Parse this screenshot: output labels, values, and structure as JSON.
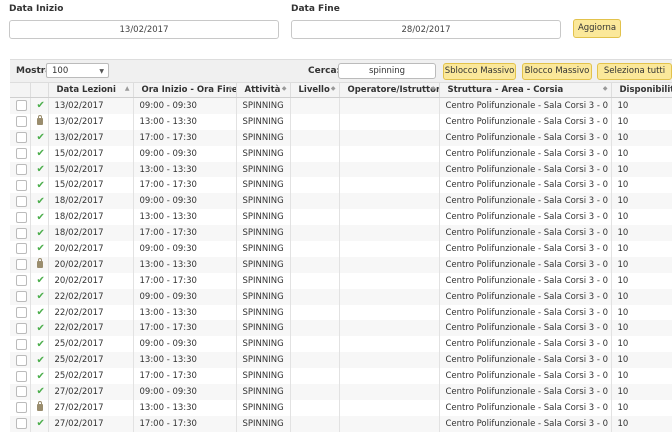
{
  "filters": {
    "start_label": "Data Inizio",
    "start_value": "13/02/2017",
    "end_label": "Data Fine",
    "end_value": "28/02/2017",
    "update_label": "Aggiorna"
  },
  "toolbar": {
    "show_label": "Mostra",
    "show_value": "100",
    "search_label": "Cerca:",
    "search_value": "spinning",
    "unlock_all": "Sblocco Massivo",
    "lock_all": "Blocco Massivo",
    "select_all": "Seleziona tutti"
  },
  "table": {
    "columns": [
      "Data Lezioni",
      "Ora Inizio - Ora Fine",
      "Attività",
      "Livello",
      "Operatore/Istruttore",
      "Struttura - Area - Corsia",
      "Disponibilità"
    ],
    "rows": [
      {
        "status": "check",
        "date": "13/02/2017",
        "time": "09:00 - 09:30",
        "activity": "SPINNING",
        "level": "",
        "operator": "",
        "structure": "Centro Polifunzionale - Sala Corsi 3 - 0",
        "avail": "10"
      },
      {
        "status": "lock",
        "date": "13/02/2017",
        "time": "13:00 - 13:30",
        "activity": "SPINNING",
        "level": "",
        "operator": "",
        "structure": "Centro Polifunzionale - Sala Corsi 3 - 0",
        "avail": "10"
      },
      {
        "status": "check",
        "date": "13/02/2017",
        "time": "17:00 - 17:30",
        "activity": "SPINNING",
        "level": "",
        "operator": "",
        "structure": "Centro Polifunzionale - Sala Corsi 3 - 0",
        "avail": "10"
      },
      {
        "status": "check",
        "date": "15/02/2017",
        "time": "09:00 - 09:30",
        "activity": "SPINNING",
        "level": "",
        "operator": "",
        "structure": "Centro Polifunzionale - Sala Corsi 3 - 0",
        "avail": "10"
      },
      {
        "status": "check",
        "date": "15/02/2017",
        "time": "13:00 - 13:30",
        "activity": "SPINNING",
        "level": "",
        "operator": "",
        "structure": "Centro Polifunzionale - Sala Corsi 3 - 0",
        "avail": "10"
      },
      {
        "status": "check",
        "date": "15/02/2017",
        "time": "17:00 - 17:30",
        "activity": "SPINNING",
        "level": "",
        "operator": "",
        "structure": "Centro Polifunzionale - Sala Corsi 3 - 0",
        "avail": "10"
      },
      {
        "status": "check",
        "date": "18/02/2017",
        "time": "09:00 - 09:30",
        "activity": "SPINNING",
        "level": "",
        "operator": "",
        "structure": "Centro Polifunzionale - Sala Corsi 3 - 0",
        "avail": "10"
      },
      {
        "status": "check",
        "date": "18/02/2017",
        "time": "13:00 - 13:30",
        "activity": "SPINNING",
        "level": "",
        "operator": "",
        "structure": "Centro Polifunzionale - Sala Corsi 3 - 0",
        "avail": "10"
      },
      {
        "status": "check",
        "date": "18/02/2017",
        "time": "17:00 - 17:30",
        "activity": "SPINNING",
        "level": "",
        "operator": "",
        "structure": "Centro Polifunzionale - Sala Corsi 3 - 0",
        "avail": "10"
      },
      {
        "status": "check",
        "date": "20/02/2017",
        "time": "09:00 - 09:30",
        "activity": "SPINNING",
        "level": "",
        "operator": "",
        "structure": "Centro Polifunzionale - Sala Corsi 3 - 0",
        "avail": "10"
      },
      {
        "status": "lock",
        "date": "20/02/2017",
        "time": "13:00 - 13:30",
        "activity": "SPINNING",
        "level": "",
        "operator": "",
        "structure": "Centro Polifunzionale - Sala Corsi 3 - 0",
        "avail": "10"
      },
      {
        "status": "check",
        "date": "20/02/2017",
        "time": "17:00 - 17:30",
        "activity": "SPINNING",
        "level": "",
        "operator": "",
        "structure": "Centro Polifunzionale - Sala Corsi 3 - 0",
        "avail": "10"
      },
      {
        "status": "check",
        "date": "22/02/2017",
        "time": "09:00 - 09:30",
        "activity": "SPINNING",
        "level": "",
        "operator": "",
        "structure": "Centro Polifunzionale - Sala Corsi 3 - 0",
        "avail": "10"
      },
      {
        "status": "check",
        "date": "22/02/2017",
        "time": "13:00 - 13:30",
        "activity": "SPINNING",
        "level": "",
        "operator": "",
        "structure": "Centro Polifunzionale - Sala Corsi 3 - 0",
        "avail": "10"
      },
      {
        "status": "check",
        "date": "22/02/2017",
        "time": "17:00 - 17:30",
        "activity": "SPINNING",
        "level": "",
        "operator": "",
        "structure": "Centro Polifunzionale - Sala Corsi 3 - 0",
        "avail": "10"
      },
      {
        "status": "check",
        "date": "25/02/2017",
        "time": "09:00 - 09:30",
        "activity": "SPINNING",
        "level": "",
        "operator": "",
        "structure": "Centro Polifunzionale - Sala Corsi 3 - 0",
        "avail": "10"
      },
      {
        "status": "check",
        "date": "25/02/2017",
        "time": "13:00 - 13:30",
        "activity": "SPINNING",
        "level": "",
        "operator": "",
        "structure": "Centro Polifunzionale - Sala Corsi 3 - 0",
        "avail": "10"
      },
      {
        "status": "check",
        "date": "25/02/2017",
        "time": "17:00 - 17:30",
        "activity": "SPINNING",
        "level": "",
        "operator": "",
        "structure": "Centro Polifunzionale - Sala Corsi 3 - 0",
        "avail": "10"
      },
      {
        "status": "check",
        "date": "27/02/2017",
        "time": "09:00 - 09:30",
        "activity": "SPINNING",
        "level": "",
        "operator": "",
        "structure": "Centro Polifunzionale - Sala Corsi 3 - 0",
        "avail": "10"
      },
      {
        "status": "lock",
        "date": "27/02/2017",
        "time": "13:00 - 13:30",
        "activity": "SPINNING",
        "level": "",
        "operator": "",
        "structure": "Centro Polifunzionale - Sala Corsi 3 - 0",
        "avail": "10"
      },
      {
        "status": "check",
        "date": "27/02/2017",
        "time": "17:00 - 17:30",
        "activity": "SPINNING",
        "level": "",
        "operator": "",
        "structure": "Centro Polifunzionale - Sala Corsi 3 - 0",
        "avail": "10"
      }
    ]
  },
  "colors": {
    "button_yellow": "#fbe89a",
    "check_green": "#4cae4c"
  }
}
